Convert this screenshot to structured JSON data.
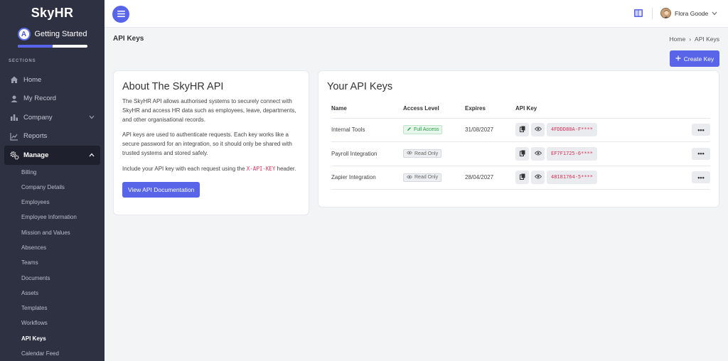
{
  "app": {
    "brand": "SkyHR"
  },
  "getting_started": {
    "badge": "A",
    "label": "Getting Started",
    "progress": 0.5
  },
  "sidebar": {
    "sections_title": "SECTIONS",
    "items": [
      {
        "label": "Home",
        "icon": "home-icon"
      },
      {
        "label": "My Record",
        "icon": "user-icon"
      },
      {
        "label": "Company",
        "icon": "bar-chart-icon",
        "has_chevron": true
      },
      {
        "label": "Reports",
        "icon": "line-chart-icon"
      },
      {
        "label": "Manage",
        "icon": "gears-icon",
        "has_chevron": true,
        "active": true
      }
    ],
    "manage_items": [
      "Billing",
      "Company Details",
      "Employees",
      "Employee Information",
      "Mission and Values",
      "Absences",
      "Teams",
      "Documents",
      "Assets",
      "Templates",
      "Workflows",
      "API Keys",
      "Calendar Feed"
    ],
    "active_sub": "API Keys"
  },
  "topbar": {
    "user_name": "Flora Goode"
  },
  "page": {
    "title": "API Keys",
    "breadcrumb": {
      "home": "Home",
      "separator": "›",
      "current": "API Keys"
    },
    "create_button": "Create Key"
  },
  "about": {
    "title": "About The SkyHR API",
    "p1": "The SkyHR API allows authorised systems to securely connect with SkyHR and access HR data such as employees, leave, departments, and other organisational records.",
    "p2": "API keys are used to authenticate requests. Each key works like a secure password for an integration, so it should only be shared with trusted systems and stored safely.",
    "p3_before": "Include your API key with each request using the ",
    "p3_code": "X-API-KEY",
    "p3_after": " header.",
    "doc_button": "View API Documentation"
  },
  "keys": {
    "title": "Your API Keys",
    "columns": {
      "name": "Name",
      "access": "Access Level",
      "expires": "Expires",
      "key": "API Key"
    },
    "rows": [
      {
        "name": "Internal Tools",
        "access": "Full Access",
        "access_type": "full",
        "expires": "31/08/2027",
        "key": "4FDDD88A-F****"
      },
      {
        "name": "Payroll Integration",
        "access": "Read Only",
        "access_type": "read",
        "expires": "",
        "key": "EF7F1725-6****"
      },
      {
        "name": "Zapier Integration",
        "access": "Read Only",
        "access_type": "read",
        "expires": "28/04/2027",
        "key": "48181764-5****"
      }
    ],
    "more_label": "•••"
  },
  "colors": {
    "accent": "#5865e8",
    "sidebar": "#2d3142",
    "key_text": "#e0305a",
    "full_access": "#2a9c47"
  }
}
